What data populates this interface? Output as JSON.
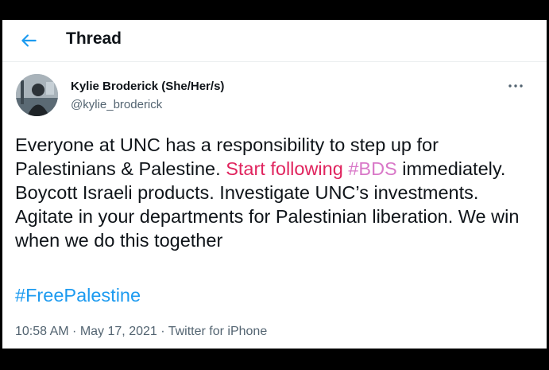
{
  "header": {
    "back_icon": "arrow-left-icon",
    "title": "Thread"
  },
  "tweet": {
    "author": {
      "display_name": "Kylie Broderick (She/Her/s)",
      "handle": "@kylie_broderick"
    },
    "more_icon": "more-horizontal-icon",
    "text_part1": "Everyone at UNC has a responsibility to step up for Palestinians & Palestine. ",
    "link1": "Start following",
    "text_part2": " ",
    "link2": "#BDS",
    "text_part3": " immediately. Boycott Israeli products. Investigate UNC’s investments. Agitate in your departments for Palestinian liberation. We win when we do this together",
    "hashtag": "#FreePalestine",
    "time": "10:58 AM",
    "separator1": " · ",
    "date": "May 17, 2021",
    "separator2": " · ",
    "source": "Twitter for iPhone"
  },
  "colors": {
    "accent": "#1d9bf0",
    "link_red": "#e0245e",
    "link_pink": "#d978c8",
    "text": "#0f1419",
    "muted": "#536471"
  }
}
